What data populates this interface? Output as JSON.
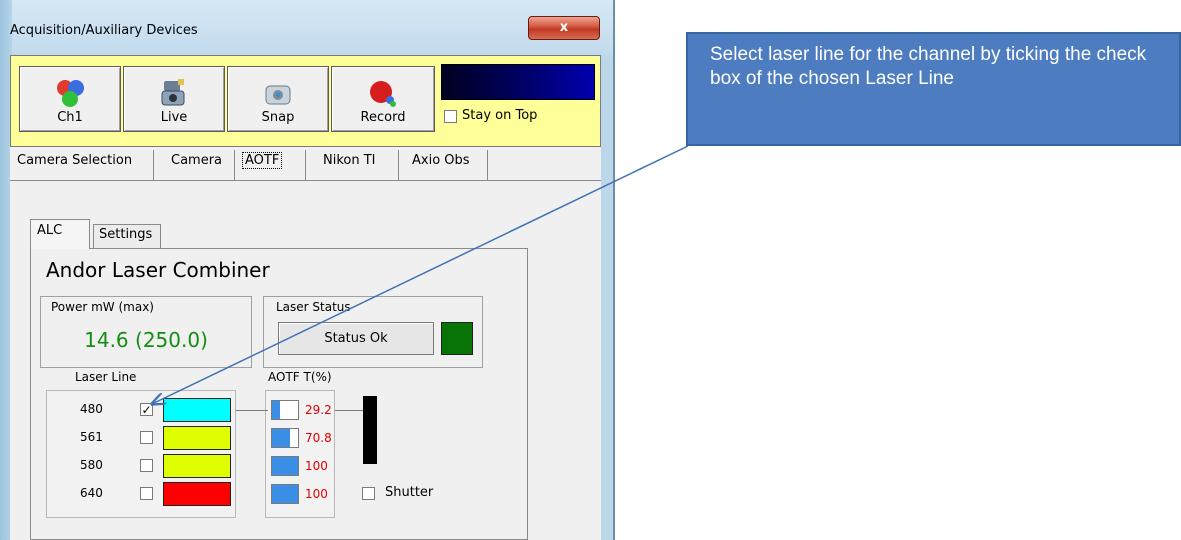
{
  "window": {
    "title": "Acquisition/Auxiliary Devices",
    "close_label": "x"
  },
  "toolbar": {
    "buttons": [
      {
        "label": "Ch1",
        "icon": "channel-icon"
      },
      {
        "label": "Live",
        "icon": "camera-live-icon"
      },
      {
        "label": "Snap",
        "icon": "snap-camera-icon"
      },
      {
        "label": "Record",
        "icon": "record-icon"
      }
    ],
    "stay_on_top_label": "Stay on Top",
    "stay_on_top_checked": false
  },
  "main_tabs": [
    "Camera Selection",
    "Camera",
    "AOTF",
    "Nikon TI",
    "Axio Obs"
  ],
  "main_tabs_active": "AOTF",
  "inner_tabs": [
    "ALC",
    "Settings"
  ],
  "inner_tabs_active": "ALC",
  "alc": {
    "title": "Andor Laser Combiner",
    "power_caption": "Power mW (max)",
    "power_value": "14.6 (250.0)",
    "status_caption": "Laser Status",
    "status_button": "Status Ok",
    "status_color": "#087408",
    "laser_line_label": "Laser Line",
    "aotf_label": "AOTF T(%)",
    "lines": [
      {
        "wavelength": "480",
        "checked": true,
        "color": "#00ffff",
        "aotf": "29.2"
      },
      {
        "wavelength": "561",
        "checked": false,
        "color": "#dfff00",
        "aotf": "70.8"
      },
      {
        "wavelength": "580",
        "checked": false,
        "color": "#dfff00",
        "aotf": "100"
      },
      {
        "wavelength": "640",
        "checked": false,
        "color": "#ff0000",
        "aotf": "100"
      }
    ],
    "shutter_label": "Shutter",
    "shutter_checked": false
  },
  "annotation": {
    "text": "Select laser line for the channel by ticking the check box of the chosen Laser Line"
  }
}
